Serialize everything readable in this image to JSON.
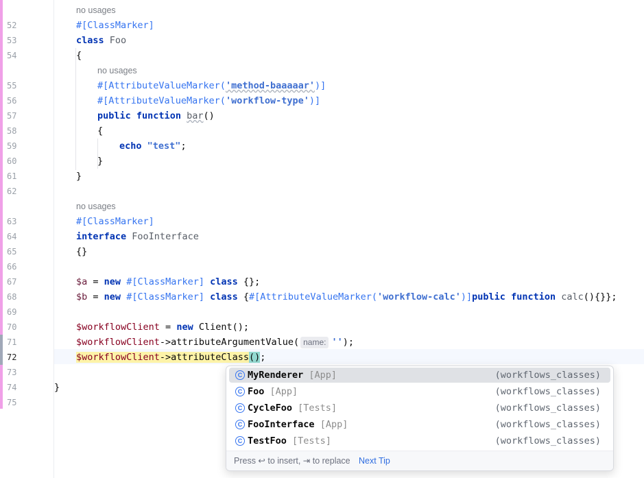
{
  "editor": {
    "line_numbers": [
      "52",
      "53",
      "54",
      "55",
      "56",
      "57",
      "58",
      "59",
      "60",
      "61",
      "62",
      "63",
      "64",
      "65",
      "66",
      "67",
      "68",
      "69",
      "70",
      "71",
      "72",
      "73",
      "74",
      "75"
    ],
    "current_line": "72",
    "hints": {
      "no_usages": "no usages"
    },
    "code": {
      "l52": "#[ClassMarker]",
      "l53_kw": "class",
      "l53_name": "Foo",
      "l54": "{",
      "l55_a": "#[AttributeValueMarker(",
      "l55_s": "'method-baaaaar'",
      "l55_b": ")]",
      "l56_a": "#[AttributeValueMarker(",
      "l56_s": "'workflow-type'",
      "l56_b": ")]",
      "l57_kw1": "public",
      "l57_kw2": "function",
      "l57_name": "bar",
      "l57_rest": "()",
      "l58": "{",
      "l59_kw": "echo",
      "l59_s": "\"test\"",
      "l59_rest": ";",
      "l60": "}",
      "l61": "}",
      "l63": "#[ClassMarker]",
      "l64_kw": "interface",
      "l64_name": "FooInterface",
      "l65": "{}",
      "l67_var": "$a",
      "l67_eq": " = ",
      "l67_new": "new",
      "l67_attr": "#[ClassMarker]",
      "l67_class": "class",
      "l67_rest": " {};",
      "l68_var": "$b",
      "l68_eq": " = ",
      "l68_new": "new",
      "l68_attr": "#[ClassMarker]",
      "l68_class": "class",
      "l68_br": " {",
      "l68_attr2": "#[AttributeValueMarker(",
      "l68_s": "'workflow-calc'",
      "l68_attr3": ")]",
      "l68_pub": "public",
      "l68_fn": "function",
      "l68_name": "calc",
      "l68_rest": "(){}};",
      "l70_var": "$workflowClient",
      "l70_eq": " = ",
      "l70_new": "new",
      "l70_rest": " Client();",
      "l71_var": "$workflowClient",
      "l71_call": "->attributeArgumentValue(",
      "l71_inlay": "name:",
      "l71_s": "''",
      "l71_rest": ");",
      "l72_var": "$workflowClient",
      "l72_call": "->attributeClass",
      "l72_paren": "()",
      "l72_rest": ";",
      "l74": "}"
    }
  },
  "completion": {
    "items": [
      {
        "name": "MyRenderer",
        "module": "[App]",
        "location": "(workflows_classes)",
        "selected": true
      },
      {
        "name": "Foo",
        "module": "[App]",
        "location": "(workflows_classes)",
        "selected": false
      },
      {
        "name": "CycleFoo",
        "module": "[Tests]",
        "location": "(workflows_classes)",
        "selected": false
      },
      {
        "name": "FooInterface",
        "module": "[App]",
        "location": "(workflows_classes)",
        "selected": false
      },
      {
        "name": "TestFoo",
        "module": "[Tests]",
        "location": "(workflows_classes)",
        "selected": false
      }
    ],
    "item_icon": "class-icon",
    "icon_letter": "C",
    "footer_text": "Press ↩ to insert, ⇥ to replace",
    "next_tip": "Next Tip"
  },
  "colors": {
    "keyword": "#0033b3",
    "attribute": "#3574f0",
    "string": "#067d17",
    "change_bar": "#f0a0e8",
    "highlight": "#fdf3a8"
  }
}
